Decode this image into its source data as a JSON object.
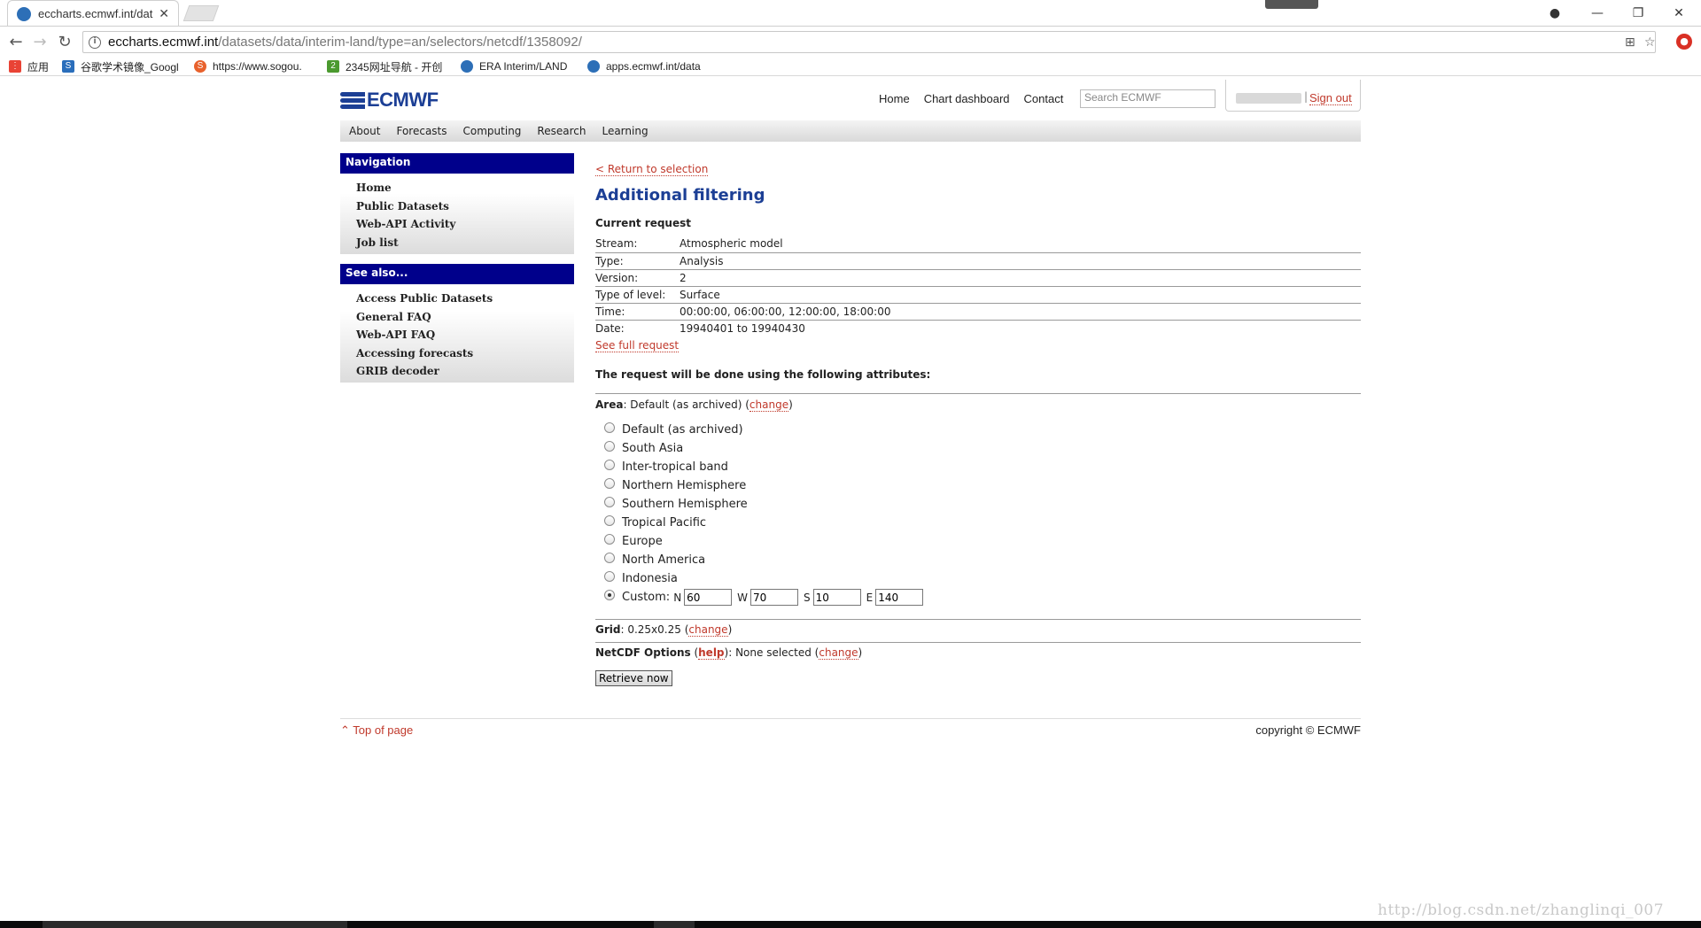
{
  "browser": {
    "tab_title": "eccharts.ecmwf.int/dat",
    "url_host": "eccharts.ecmwf.int",
    "url_path": "/datasets/data/interim-land/type=an/selectors/netcdf/1358092/",
    "bookmarks": [
      {
        "label": "应用",
        "icon": "apps-grid-icon",
        "color": "#e94335"
      },
      {
        "label": "谷歌学术镜像_Googl",
        "icon": "scholar-icon",
        "color": "#2a6ebb"
      },
      {
        "label": "https://www.sogou.",
        "icon": "sogou-icon",
        "color": "#e8612c"
      },
      {
        "label": "2345网址导航 - 开创",
        "icon": "2345-icon",
        "color": "#4b9a2f"
      },
      {
        "label": "ERA Interim/LAND",
        "icon": "drupal-icon",
        "color": "#2d6fb7"
      },
      {
        "label": "apps.ecmwf.int/data",
        "icon": "drupal-icon",
        "color": "#2d6fb7"
      }
    ]
  },
  "header": {
    "logo_text": "ECMWF",
    "links": [
      "Home",
      "Chart dashboard",
      "Contact"
    ],
    "search_placeholder": "Search ECMWF",
    "sign_out": "Sign out"
  },
  "mainnav": [
    "About",
    "Forecasts",
    "Computing",
    "Research",
    "Learning"
  ],
  "sidebar": {
    "navigation": {
      "title": "Navigation",
      "items": [
        "Home",
        "Public Datasets",
        "Web-API Activity",
        "Job list"
      ]
    },
    "see_also": {
      "title": "See also...",
      "items": [
        "Access Public Datasets",
        "General FAQ",
        "Web-API FAQ",
        "Accessing forecasts",
        "GRIB decoder"
      ]
    }
  },
  "content": {
    "return_link": "< Return to selection",
    "heading": "Additional filtering",
    "current_request_label": "Current request",
    "request_rows": [
      {
        "key": "Stream:",
        "value": "Atmospheric model"
      },
      {
        "key": "Type:",
        "value": "Analysis"
      },
      {
        "key": "Version:",
        "value": "2"
      },
      {
        "key": "Type of level:",
        "value": "Surface"
      },
      {
        "key": "Time:",
        "value": "00:00:00, 06:00:00, 12:00:00, 18:00:00"
      },
      {
        "key": "Date:",
        "value": "19940401 to 19940430"
      }
    ],
    "see_full_request": "See full request",
    "attributes_heading": "The request will be done using the following attributes:",
    "area": {
      "label": "Area",
      "value": ": Default (as archived)",
      "change": "change",
      "options": [
        "Default (as archived)",
        "South Asia",
        "Inter-tropical band",
        "Northern Hemisphere",
        "Southern Hemisphere",
        "Tropical Pacific",
        "Europe",
        "North America",
        "Indonesia"
      ],
      "custom_label": "Custom:",
      "custom": {
        "N": "60",
        "W": "70",
        "S": "10",
        "E": "140"
      },
      "selected": "Custom"
    },
    "grid": {
      "label": "Grid",
      "value": ": 0.25x0.25",
      "change": "change"
    },
    "netcdf": {
      "label": "NetCDF Options",
      "help": "help",
      "value": ": None selected",
      "change": "change"
    },
    "retrieve_button": "Retrieve now"
  },
  "footer": {
    "top_of_page": "Top of page",
    "copyright": "copyright © ECMWF"
  },
  "watermark": "http://blog.csdn.net/zhanglinqi_007"
}
